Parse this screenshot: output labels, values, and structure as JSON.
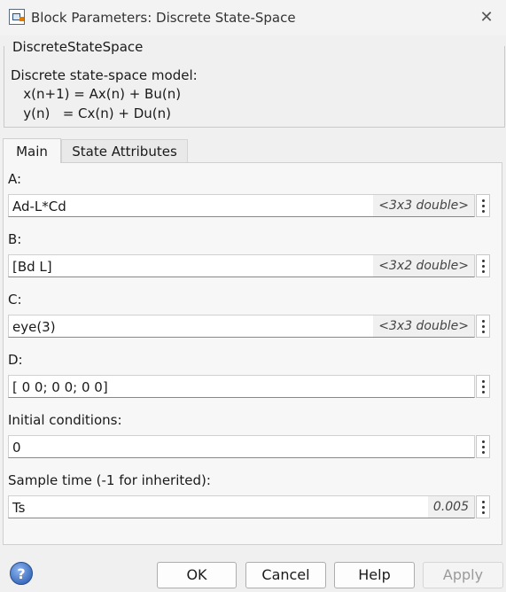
{
  "window": {
    "title": "Block Parameters: Discrete State-Space",
    "close_glyph": "✕"
  },
  "block": {
    "name": "DiscreteStateSpace",
    "description_lines": [
      "Discrete state-space model:",
      "   x(n+1) = Ax(n) + Bu(n)",
      "   y(n)   = Cx(n) + Du(n)"
    ]
  },
  "tabs": [
    {
      "label": "Main",
      "active": true
    },
    {
      "label": "State Attributes",
      "active": false
    }
  ],
  "params": [
    {
      "label": "A:",
      "value": "Ad-L*Cd",
      "hint": "<3x3 double>"
    },
    {
      "label": "B:",
      "value": "[Bd L]",
      "hint": "<3x2 double>"
    },
    {
      "label": "C:",
      "value": "eye(3)",
      "hint": "<3x3 double>"
    },
    {
      "label": "D:",
      "value": "[ 0 0; 0 0; 0 0]",
      "hint": ""
    },
    {
      "label": "Initial conditions:",
      "value": "0",
      "hint": ""
    },
    {
      "label": "Sample time (-1 for inherited):",
      "value": "Ts",
      "hint": "0.005"
    }
  ],
  "buttons": {
    "ok": "OK",
    "cancel": "Cancel",
    "help": "Help",
    "apply": "Apply",
    "help_icon_glyph": "?"
  },
  "icons": {
    "title": "simulink-block-icon",
    "close": "close-icon",
    "more": "vertical-ellipsis-icon",
    "help": "help-question-icon"
  }
}
